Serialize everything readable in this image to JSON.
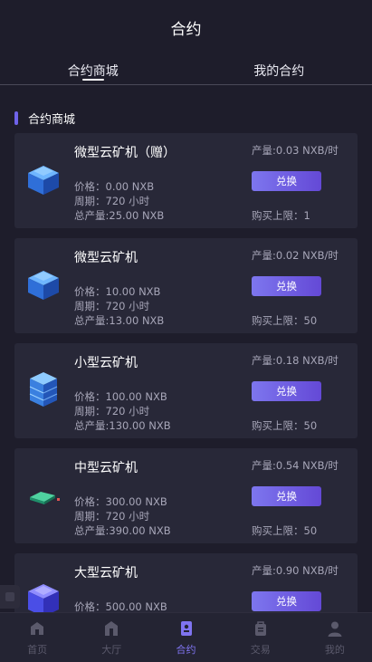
{
  "header": {
    "title": "合约"
  },
  "tabs": [
    {
      "label": "合约商城"
    },
    {
      "label": "我的合约"
    }
  ],
  "section": {
    "title": "合约商城"
  },
  "cards": [
    {
      "name": "微型云矿机（赠）",
      "price": "价格：0.00 NXB",
      "cycle": "周期：720 小时",
      "total": "总产量:25.00 NXB",
      "yield": "产量:0.03 NXB/时",
      "button": "兑换",
      "limit": "购买上限：1"
    },
    {
      "name": "微型云矿机",
      "price": "价格：10.00 NXB",
      "cycle": "周期：720 小时",
      "total": "总产量:13.00 NXB",
      "yield": "产量:0.02 NXB/时",
      "button": "兑换",
      "limit": "购买上限：50"
    },
    {
      "name": "小型云矿机",
      "price": "价格：100.00 NXB",
      "cycle": "周期：720 小时",
      "total": "总产量:130.00 NXB",
      "yield": "产量:0.18 NXB/时",
      "button": "兑换",
      "limit": "购买上限：50"
    },
    {
      "name": "中型云矿机",
      "price": "价格：300.00 NXB",
      "cycle": "周期：720 小时",
      "total": "总产量:390.00 NXB",
      "yield": "产量:0.54 NXB/时",
      "button": "兑换",
      "limit": "购买上限：50"
    },
    {
      "name": "大型云矿机",
      "price": "价格：500.00 NXB",
      "cycle": "",
      "total": "",
      "yield": "产量:0.90 NXB/时",
      "button": "兑换",
      "limit": ""
    }
  ],
  "tabbar": [
    {
      "label": "首页",
      "icon": "home-icon"
    },
    {
      "label": "大厅",
      "icon": "hall-icon"
    },
    {
      "label": "合约",
      "icon": "contract-icon"
    },
    {
      "label": "交易",
      "icon": "trade-icon"
    },
    {
      "label": "我的",
      "icon": "user-icon"
    }
  ],
  "colors": {
    "accent": "#6f63ea",
    "background": "#1e1d2b",
    "card": "#282838",
    "muted_text": "#a7a6b8"
  }
}
